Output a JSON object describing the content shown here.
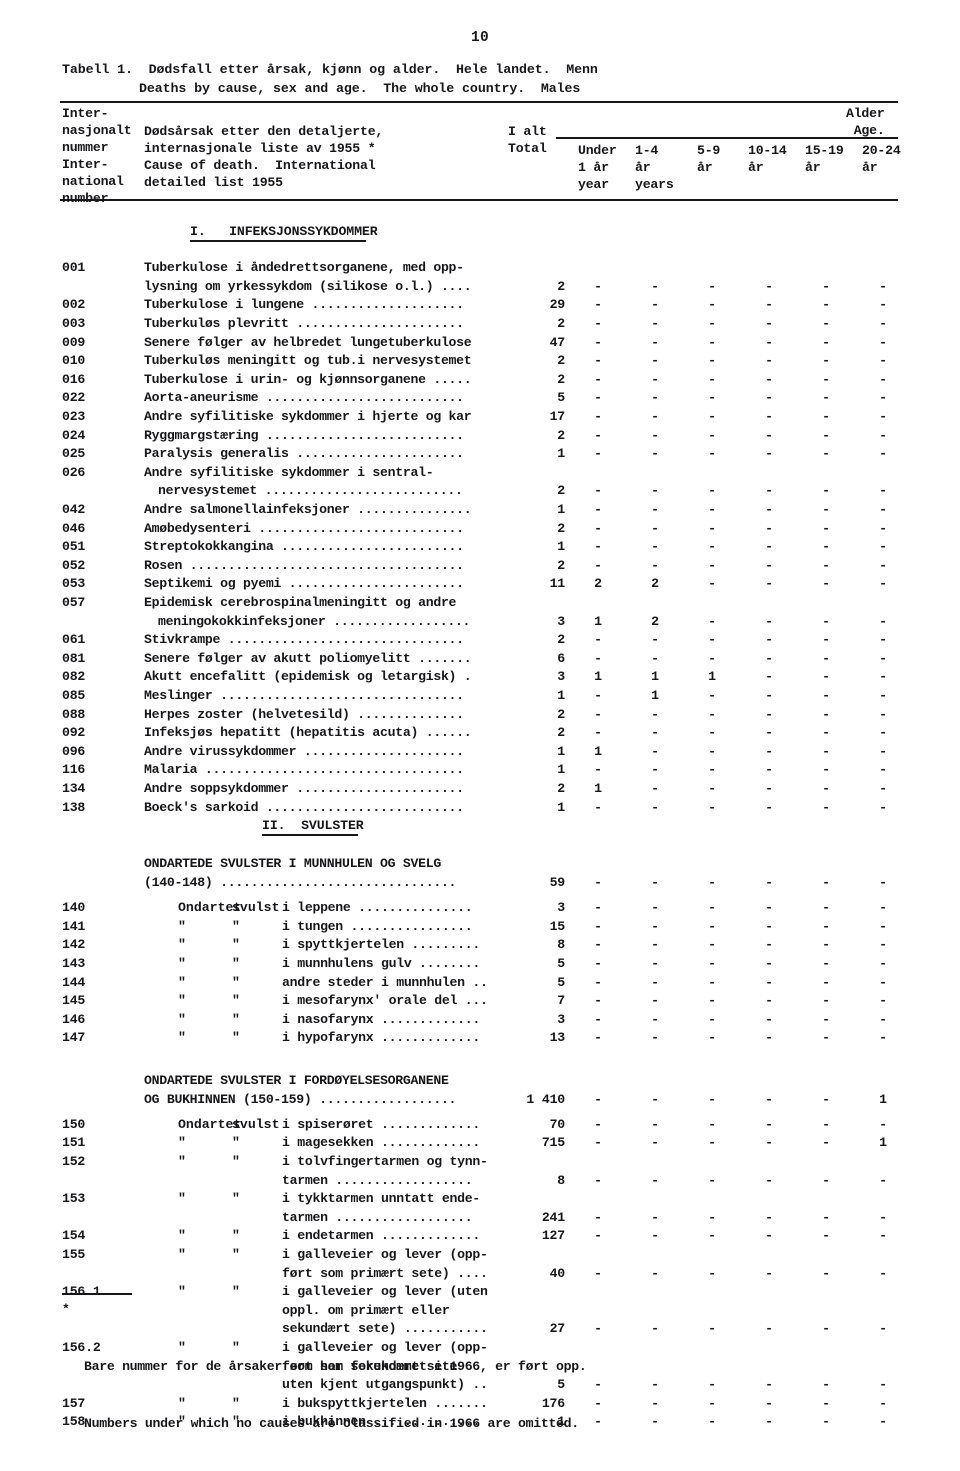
{
  "page": {
    "number": "10"
  },
  "title": {
    "line1": "Tabell 1.  Dødsfall etter årsak, kjønn og alder.  Hele landet.  Menn",
    "line2": "Deaths by cause, sex and age.  The whole country.  Males"
  },
  "header": {
    "int_number": "Inter-\nnasjonalt\nnummer\nInter-\nnational\nnumber",
    "cause": "Dødsårsak etter den detaljerte,\ninternasjonale liste av 1955 *\nCause of death.  International\ndetailed list 1955",
    "total": "I alt\nTotal",
    "alder": "Alder\nAge.",
    "age_columns": [
      {
        "l1": "Under",
        "l2": "1 år",
        "l3": "year"
      },
      {
        "l1": "1-4",
        "l2": "år",
        "l3": "years"
      },
      {
        "l1": "5-9",
        "l2": "år",
        "l3": ""
      },
      {
        "l1": "10-14",
        "l2": "år",
        "l3": ""
      },
      {
        "l1": "15-19",
        "l2": "år",
        "l3": ""
      },
      {
        "l1": "20-24",
        "l2": "år",
        "l3": ""
      }
    ]
  },
  "sections": [
    {
      "heading": "I.   INFEKSJONSSYKDOMMER",
      "rows": [
        {
          "code": "001",
          "label": "Tuberkulose i åndedrettsorganene, med opp-",
          "values": []
        },
        {
          "code": "",
          "label": "lysning om yrkessykdom (silikose o.l.) ....",
          "values": [
            "2",
            "-",
            "-",
            "-",
            "-",
            "-",
            "-"
          ]
        },
        {
          "code": "002",
          "label": "Tuberkulose i lungene ....................",
          "values": [
            "29",
            "-",
            "-",
            "-",
            "-",
            "-",
            "-"
          ]
        },
        {
          "code": "003",
          "label": "Tuberkuløs plevritt ......................",
          "values": [
            "2",
            "-",
            "-",
            "-",
            "-",
            "-",
            "-"
          ]
        },
        {
          "code": "009",
          "label": "Senere følger av helbredet lungetuberkulose",
          "values": [
            "47",
            "-",
            "-",
            "-",
            "-",
            "-",
            "-"
          ]
        },
        {
          "code": "010",
          "label": "Tuberkuløs meningitt og tub.i nervesystemet",
          "values": [
            "2",
            "-",
            "-",
            "-",
            "-",
            "-",
            "-"
          ]
        },
        {
          "code": "016",
          "label": "Tuberkulose i urin- og kjønnsorganene .....",
          "values": [
            "2",
            "-",
            "-",
            "-",
            "-",
            "-",
            "-"
          ]
        },
        {
          "code": "022",
          "label": "Aorta-aneurisme ..........................",
          "values": [
            "5",
            "-",
            "-",
            "-",
            "-",
            "-",
            "-"
          ]
        },
        {
          "code": "023",
          "label": "Andre syfilitiske sykdommer i hjerte og kar",
          "values": [
            "17",
            "-",
            "-",
            "-",
            "-",
            "-",
            "-"
          ]
        },
        {
          "code": "024",
          "label": "Ryggmargstæring ..........................",
          "values": [
            "2",
            "-",
            "-",
            "-",
            "-",
            "-",
            "-"
          ]
        },
        {
          "code": "025",
          "label": "Paralysis generalis ......................",
          "values": [
            "1",
            "-",
            "-",
            "-",
            "-",
            "-",
            "-"
          ]
        },
        {
          "code": "026",
          "label": "Andre syfilitiske sykdommer i sentral-",
          "values": []
        },
        {
          "code": "",
          "label": "nervesystemet ..........................",
          "indent": true,
          "values": [
            "2",
            "-",
            "-",
            "-",
            "-",
            "-",
            "-"
          ]
        },
        {
          "code": "042",
          "label": "Andre salmonellainfeksjoner ...............",
          "values": [
            "1",
            "-",
            "-",
            "-",
            "-",
            "-",
            "-"
          ]
        },
        {
          "code": "046",
          "label": "Amøbedysenteri ...........................",
          "values": [
            "2",
            "-",
            "-",
            "-",
            "-",
            "-",
            "-"
          ]
        },
        {
          "code": "051",
          "label": "Streptokokkangina ........................",
          "values": [
            "1",
            "-",
            "-",
            "-",
            "-",
            "-",
            "-"
          ]
        },
        {
          "code": "052",
          "label": "Rosen ....................................",
          "values": [
            "2",
            "-",
            "-",
            "-",
            "-",
            "-",
            "-"
          ]
        },
        {
          "code": "053",
          "label": "Septikemi og pyemi .......................",
          "values": [
            "11",
            "2",
            "2",
            "-",
            "-",
            "-",
            "-"
          ]
        },
        {
          "code": "057",
          "label": "Epidemisk cerebrospinalmeningitt og andre",
          "values": []
        },
        {
          "code": "",
          "label": "meningokokkinfeksjoner ..................",
          "indent": true,
          "values": [
            "3",
            "1",
            "2",
            "-",
            "-",
            "-",
            "-"
          ]
        },
        {
          "code": "061",
          "label": "Stivkrampe ...............................",
          "values": [
            "2",
            "-",
            "-",
            "-",
            "-",
            "-",
            "-"
          ]
        },
        {
          "code": "081",
          "label": "Senere følger av akutt poliomyelitt .......",
          "values": [
            "6",
            "-",
            "-",
            "-",
            "-",
            "-",
            "-"
          ]
        },
        {
          "code": "082",
          "label": "Akutt encefalitt (epidemisk og letargisk) .",
          "values": [
            "3",
            "1",
            "1",
            "1",
            "-",
            "-",
            "-"
          ]
        },
        {
          "code": "085",
          "label": "Meslinger ................................",
          "values": [
            "1",
            "-",
            "1",
            "-",
            "-",
            "-",
            "-"
          ]
        },
        {
          "code": "088",
          "label": "Herpes zoster (helvetesild) ..............",
          "values": [
            "2",
            "-",
            "-",
            "-",
            "-",
            "-",
            "-"
          ]
        },
        {
          "code": "092",
          "label": "Infeksjøs hepatitt (hepatitis acuta) ......",
          "values": [
            "2",
            "-",
            "-",
            "-",
            "-",
            "-",
            "-"
          ]
        },
        {
          "code": "096",
          "label": "Andre virussykdommer .....................",
          "values": [
            "1",
            "1",
            "-",
            "-",
            "-",
            "-",
            "-"
          ]
        },
        {
          "code": "116",
          "label": "Malaria ..................................",
          "values": [
            "1",
            "-",
            "-",
            "-",
            "-",
            "-",
            "-"
          ]
        },
        {
          "code": "134",
          "label": "Andre soppsykdommer ......................",
          "values": [
            "2",
            "1",
            "-",
            "-",
            "-",
            "-",
            "-"
          ]
        },
        {
          "code": "138",
          "label": "Boeck's sarkoid ..........................",
          "values": [
            "1",
            "-",
            "-",
            "-",
            "-",
            "-",
            "-"
          ]
        }
      ]
    },
    {
      "heading": "II.  SVULSTER",
      "groups": [
        {
          "title_line1": "ONDARTEDE SVULSTER I MUNNHULEN OG SVELG",
          "title_line2": "(140-148) ...............................",
          "values": [
            "59",
            "-",
            "-",
            "-",
            "-",
            "-",
            "-"
          ],
          "rows": [
            {
              "code": "140",
              "q1": "Ondartet",
              "q2": "svulst",
              "label": "i leppene ...............",
              "values": [
                "3",
                "-",
                "-",
                "-",
                "-",
                "-",
                "-"
              ]
            },
            {
              "code": "141",
              "q1": "\"",
              "q2": "\"",
              "label": "i tungen ................",
              "values": [
                "15",
                "-",
                "-",
                "-",
                "-",
                "-",
                "-"
              ]
            },
            {
              "code": "142",
              "q1": "\"",
              "q2": "\"",
              "label": "i spyttkjertelen .........",
              "values": [
                "8",
                "-",
                "-",
                "-",
                "-",
                "-",
                "-"
              ]
            },
            {
              "code": "143",
              "q1": "\"",
              "q2": "\"",
              "label": "i munnhulens gulv ........",
              "values": [
                "5",
                "-",
                "-",
                "-",
                "-",
                "-",
                "-"
              ]
            },
            {
              "code": "144",
              "q1": "\"",
              "q2": "\"",
              "label": "andre steder i munnhulen ..",
              "values": [
                "5",
                "-",
                "-",
                "-",
                "-",
                "-",
                "-"
              ]
            },
            {
              "code": "145",
              "q1": "\"",
              "q2": "\"",
              "label": "i mesofarynx' orale del ...",
              "values": [
                "7",
                "-",
                "-",
                "-",
                "-",
                "-",
                "-"
              ]
            },
            {
              "code": "146",
              "q1": "\"",
              "q2": "\"",
              "label": "i nasofarynx .............",
              "values": [
                "3",
                "-",
                "-",
                "-",
                "-",
                "-",
                "-"
              ]
            },
            {
              "code": "147",
              "q1": "\"",
              "q2": "\"",
              "label": "i hypofarynx .............",
              "values": [
                "13",
                "-",
                "-",
                "-",
                "-",
                "-",
                "-"
              ]
            }
          ]
        },
        {
          "title_line1": "ONDARTEDE SVULSTER I FORDØYELSESORGANENE",
          "title_line2": "OG BUKHINNEN (150-159) ..................",
          "values": [
            "1 410",
            "-",
            "-",
            "-",
            "-",
            "-",
            "1"
          ],
          "rows": [
            {
              "code": "150",
              "q1": "Ondartet",
              "q2": "svulst",
              "label": "i spiserøret .............",
              "values": [
                "70",
                "-",
                "-",
                "-",
                "-",
                "-",
                "-"
              ]
            },
            {
              "code": "151",
              "q1": "\"",
              "q2": "\"",
              "label": "i magesekken .............",
              "values": [
                "715",
                "-",
                "-",
                "-",
                "-",
                "-",
                "1"
              ]
            },
            {
              "code": "152",
              "q1": "\"",
              "q2": "\"",
              "label": "i tolvfingertarmen og tynn-",
              "values": []
            },
            {
              "code": "",
              "q1": "",
              "q2": "",
              "label": "tarmen ..................",
              "deep": true,
              "values": [
                "8",
                "-",
                "-",
                "-",
                "-",
                "-",
                "-"
              ]
            },
            {
              "code": "153",
              "q1": "\"",
              "q2": "\"",
              "label": "i tykktarmen unntatt ende-",
              "values": []
            },
            {
              "code": "",
              "q1": "",
              "q2": "",
              "label": "tarmen ..................",
              "deep": true,
              "values": [
                "241",
                "-",
                "-",
                "-",
                "-",
                "-",
                "-"
              ]
            },
            {
              "code": "154",
              "q1": "\"",
              "q2": "\"",
              "label": "i endetarmen .............",
              "values": [
                "127",
                "-",
                "-",
                "-",
                "-",
                "-",
                "-"
              ]
            },
            {
              "code": "155",
              "q1": "\"",
              "q2": "\"",
              "label": "i galleveier og lever (opp-",
              "values": []
            },
            {
              "code": "",
              "q1": "",
              "q2": "",
              "label": "ført som primært sete) ....",
              "deep": true,
              "values": [
                "40",
                "-",
                "-",
                "-",
                "-",
                "-",
                "-"
              ]
            },
            {
              "code": "156.1",
              "q1": "\"",
              "q2": "\"",
              "label": "i galleveier og lever (uten",
              "values": []
            },
            {
              "code": "",
              "q1": "",
              "q2": "",
              "label": "oppl. om primært eller",
              "deep": true,
              "values": []
            },
            {
              "code": "",
              "q1": "",
              "q2": "",
              "label": "sekundært sete) ...........",
              "deep": true,
              "values": [
                "27",
                "-",
                "-",
                "-",
                "-",
                "-",
                "-"
              ]
            },
            {
              "code": "156.2",
              "q1": "\"",
              "q2": "\"",
              "label": "i galleveier og lever (opp-",
              "values": []
            },
            {
              "code": "",
              "q1": "",
              "q2": "",
              "label": "ført som sekundært sete",
              "deep": true,
              "values": []
            },
            {
              "code": "",
              "q1": "",
              "q2": "",
              "label": "uten kjent utgangspunkt) ..",
              "deep": true,
              "values": [
                "5",
                "-",
                "-",
                "-",
                "-",
                "-",
                "-"
              ]
            },
            {
              "code": "157",
              "q1": "\"",
              "q2": "\"",
              "label": "i bukspyttkjertelen .......",
              "values": [
                "176",
                "-",
                "-",
                "-",
                "-",
                "-",
                "-"
              ]
            },
            {
              "code": "158",
              "q1": "\"",
              "q2": "\"",
              "label": "i bukhinnen ..............",
              "values": [
                "1",
                "-",
                "-",
                "-",
                "-",
                "-",
                "-"
              ]
            }
          ]
        }
      ]
    }
  ],
  "footnote": {
    "marker": "*",
    "line1": "Bare nummer for de årsaker som har forekommet i 1966, er ført opp.",
    "line2": "Numbers under which no causes are classified in 1966 are omitted."
  }
}
